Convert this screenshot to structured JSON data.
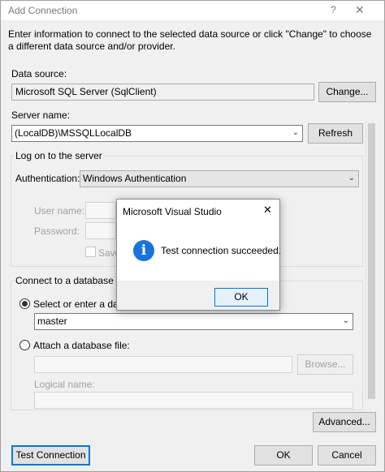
{
  "window": {
    "title": "Add Connection",
    "help": "?",
    "close": "✕"
  },
  "intro": "Enter information to connect to the selected data source or click \"Change\" to choose a different data source and/or provider.",
  "data_source": {
    "label": "Data source:",
    "value": "Microsoft SQL Server (SqlClient)",
    "change_button": "Change..."
  },
  "server": {
    "label": "Server name:",
    "value": "(LocalDB)\\MSSQLLocalDB",
    "refresh_button": "Refresh"
  },
  "logon": {
    "group_title": "Log on to the server",
    "auth_label": "Authentication:",
    "auth_value": "Windows Authentication",
    "user_label": "User name:",
    "password_label": "Password:",
    "save_label": "Save"
  },
  "database": {
    "group_title": "Connect to a database",
    "select_label": "Select or enter a database name:",
    "select_value": "master",
    "attach_label": "Attach a database file:",
    "browse_button": "Browse...",
    "logical_label": "Logical name:"
  },
  "footer": {
    "advanced_button": "Advanced...",
    "test_button": "Test Connection",
    "ok_button": "OK",
    "cancel_button": "Cancel"
  },
  "dialog": {
    "title": "Microsoft Visual Studio",
    "close": "✕",
    "message": "Test connection succeeded.",
    "ok_button": "OK",
    "icon": "info-icon"
  }
}
